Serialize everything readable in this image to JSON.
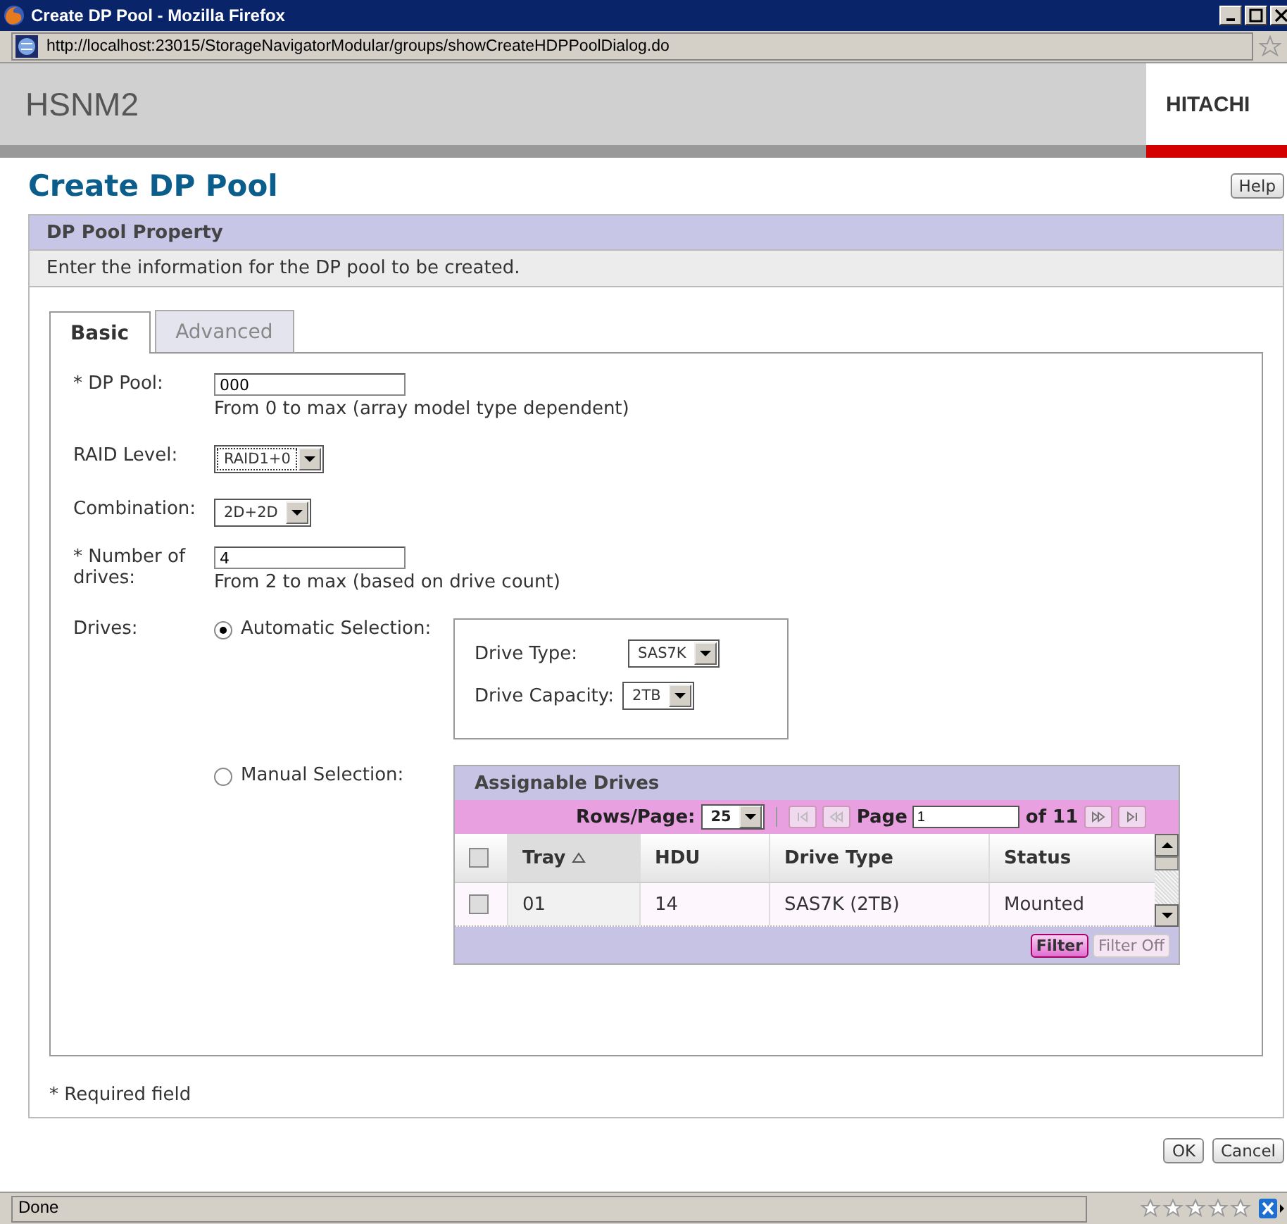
{
  "window": {
    "title": "Create DP Pool - Mozilla Firefox"
  },
  "address": "http://localhost:23015/StorageNavigatorModular/groups/showCreateHDPPoolDialog.do",
  "header": {
    "product": "HSNM2",
    "brand": "HITACHI"
  },
  "page": {
    "title": "Create DP Pool",
    "help": "Help"
  },
  "section": {
    "title": "DP Pool Property",
    "description": "Enter the information for the DP pool to be created."
  },
  "tabs": [
    {
      "label": "Basic",
      "selected": true
    },
    {
      "label": "Advanced",
      "selected": false
    }
  ],
  "form": {
    "dp_pool": {
      "label": "* DP Pool:",
      "value": "000",
      "hint": "From 0 to max (array model type dependent)"
    },
    "raid_level": {
      "label": "RAID Level:",
      "value": "RAID1+0"
    },
    "combination": {
      "label": "Combination:",
      "value": "2D+2D"
    },
    "drives_count": {
      "label": "* Number of drives:",
      "value": "4",
      "hint": "From 2 to max (based on drive count)"
    },
    "drives": {
      "label": "Drives:",
      "options": [
        {
          "label": "Automatic Selection:",
          "selected": true
        },
        {
          "label": "Manual Selection:",
          "selected": false
        }
      ],
      "drive_type": {
        "label": "Drive Type:",
        "value": "SAS7K"
      },
      "drive_capacity": {
        "label": "Drive Capacity:",
        "value": "2TB"
      }
    }
  },
  "assignable_drives": {
    "title": "Assignable Drives",
    "rows_per_page_label": "Rows/Page:",
    "rows_per_page": "25",
    "page_label": "Page",
    "page": "1",
    "page_total": "of 11",
    "select_all": {
      "checked": false
    },
    "columns": [
      "Tray",
      "HDU",
      "Drive Type",
      "Status"
    ],
    "rows": [
      {
        "checked": false,
        "cells": [
          "01",
          "14",
          "SAS7K (2TB)",
          "Mounted"
        ]
      }
    ],
    "filter": "Filter",
    "filter_off": "Filter Off"
  },
  "required_note": "* Required field",
  "buttons": [
    "OK",
    "Cancel"
  ],
  "status_bar": "Done"
}
